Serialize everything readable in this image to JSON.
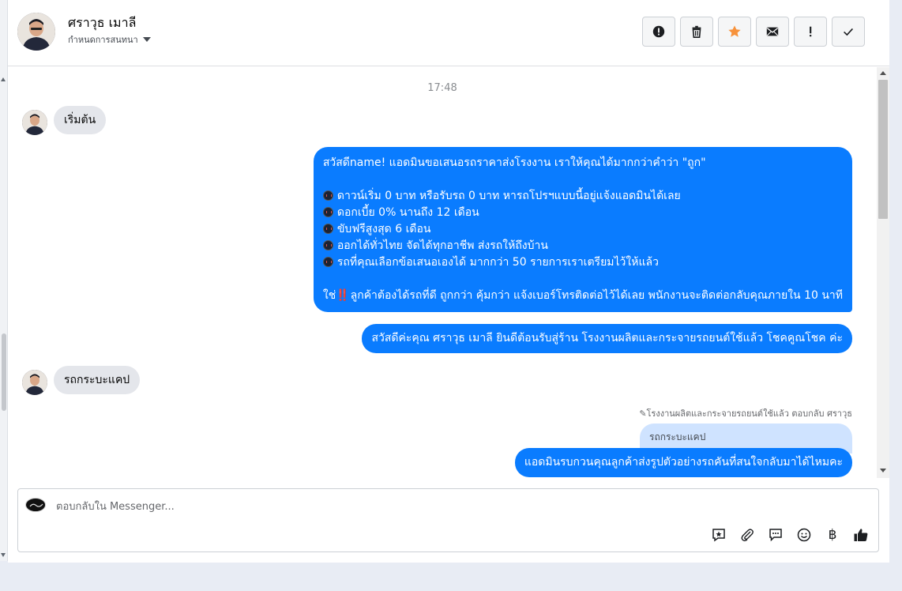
{
  "header": {
    "contact_name": "ศราวุธ เมาลี",
    "conversation_label": "กำหนดการสนทนา",
    "actions": [
      {
        "name": "spam-button",
        "icon": "alert-circle-icon"
      },
      {
        "name": "delete-button",
        "icon": "trash-icon"
      },
      {
        "name": "star-button",
        "icon": "star-icon"
      },
      {
        "name": "mark-unread-button",
        "icon": "envelope-icon"
      },
      {
        "name": "follow-up-button",
        "icon": "exclamation-icon"
      },
      {
        "name": "mark-done-button",
        "icon": "check-icon"
      }
    ]
  },
  "chat": {
    "timestamp": "17:48",
    "incoming_1": "เริ่มต้น",
    "outgoing_offer": {
      "line1": "สวัสดีname! แอดมินขอเสนอรถราคาส่งโรงงาน เราให้คุณได้มากกว่าคำว่า \"ถูก\"",
      "bullets": [
        "ดาวน์เริ่ม 0 บาท หรือรับรถ 0 บาท หารถโปรฯแบบนี้อยู่แจ้งแอดมินได้เลย",
        "ดอกเบี้ย 0% นานถึง 12 เดือน",
        "ขับฟรีสูงสุด 6 เดือน",
        "ออกได้ทั่วไทย จัดได้ทุกอาชีพ ส่งรถให้ถึงบ้าน",
        "รถที่คุณเลือกข้อเสนอเองได้ มากกว่า 50 รายการเราเตรียมไว้ให้แล้ว"
      ],
      "closing_prefix": "ใช่",
      "closing_emphasis": "‼️",
      "closing_text": "ลูกค้าต้องได้รถที่ดี ถูกกว่า คุ้มกว่า แจ้งเบอร์โทรติดต่อไว้ได้เลย พนักงานจะติดต่อกลับคุณภายใน 10 นาที"
    },
    "outgoing_welcome": "สวัสดีค่ะคุณ ศราวุธ เมาลี ยินดีต้อนรับสู่ร้าน โรงงานผลิตและกระจายรถยนต์ใช้แล้ว โชคคูณโชค ค่ะ",
    "incoming_2": "รถกระบะแคป",
    "reply_meta": "โรงงานผลิตและกระจายรถยนต์ใช้แล้ว ตอบกลับ ศราวุธ",
    "reply_quote": "รถกระบะแคป",
    "outgoing_reply": "แอดมินรบกวนคุณลูกค้าส่งรูปตัวอย่างรถคันที่สนใจกลับมาได้ไหมคะ"
  },
  "composer": {
    "placeholder": "ตอบกลับใน Messenger...",
    "tools": [
      "saved-reply-icon",
      "attachment-icon",
      "chat-bubble-icon",
      "emoji-icon",
      "baht-icon",
      "thumbs-up-icon"
    ],
    "baht_symbol": "฿"
  },
  "colors": {
    "outgoing_bubble": "#0a7cff",
    "incoming_bubble": "#e4e6eb",
    "reply_quote_bg": "#cfe3ff",
    "star": "#f7923b"
  }
}
